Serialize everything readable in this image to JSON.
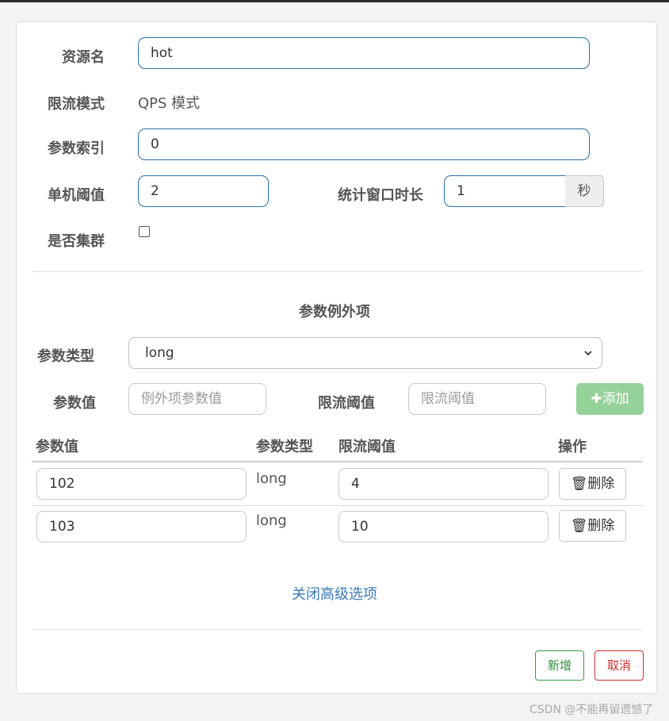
{
  "form": {
    "resource_label": "资源名",
    "resource_value": "hot",
    "mode_label": "限流模式",
    "mode_value": "QPS 模式",
    "param_index_label": "参数索引",
    "param_index_value": "0",
    "threshold_label": "单机阈值",
    "threshold_value": "2",
    "window_label": "统计窗口时长",
    "window_value": "1",
    "window_unit": "秒",
    "cluster_label": "是否集群",
    "cluster_checked": false
  },
  "exceptions": {
    "title": "参数例外项",
    "type_label": "参数类型",
    "type_selected": "long",
    "value_label": "参数值",
    "value_placeholder": "例外项参数值",
    "limit_label": "限流阈值",
    "limit_placeholder": "限流阈值",
    "add_button_label": "添加",
    "table": {
      "headers": [
        "参数值",
        "参数类型",
        "限流阈值",
        "操作"
      ],
      "rows": [
        {
          "value": "102",
          "type": "long",
          "limit": "4",
          "action": "删除"
        },
        {
          "value": "103",
          "type": "long",
          "limit": "10",
          "action": "删除"
        }
      ]
    }
  },
  "advanced_link": "关闭高级选项",
  "footer": {
    "ok_label": "新增",
    "cancel_label": "取消"
  },
  "watermark": "CSDN @不能再留遗憾了",
  "colors": {
    "input_border": "#2f6ea5",
    "add_button": "#95d29a",
    "ok_button": "#3a9a4a",
    "cancel_button": "#c9302c",
    "link": "#3a7ab8"
  }
}
